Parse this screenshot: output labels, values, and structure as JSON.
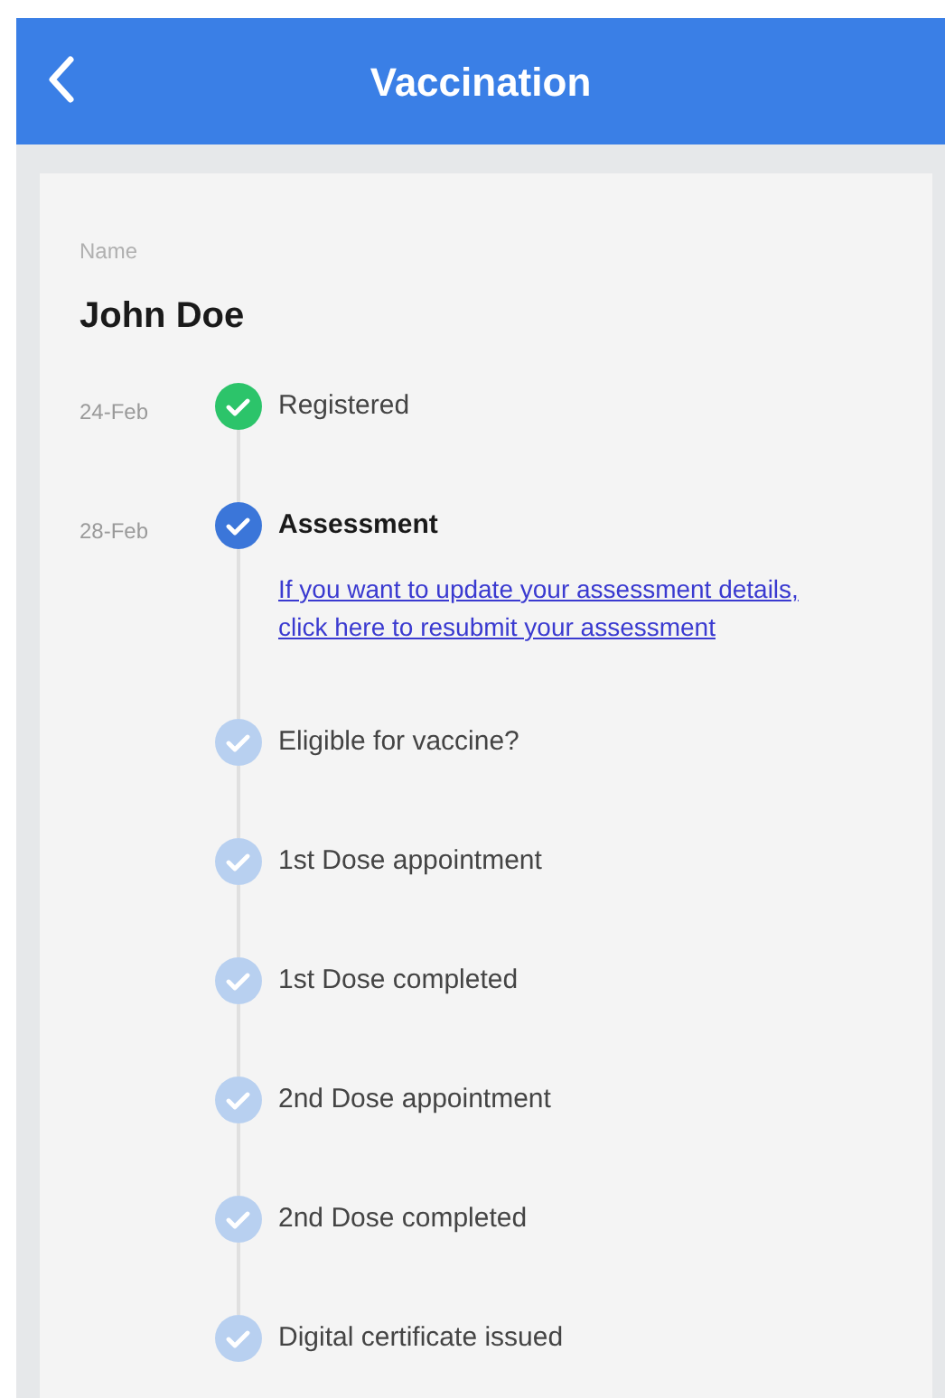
{
  "header": {
    "title": "Vaccination"
  },
  "name_label": "Name",
  "name": "John Doe",
  "steps": [
    {
      "date": "24-Feb",
      "label": "Registered",
      "kind": "done"
    },
    {
      "date": "28-Feb",
      "label": "Assessment",
      "kind": "current",
      "link": "If you want to update your assessment details, click here to resubmit your assessment"
    },
    {
      "label": "Eligible for vaccine?",
      "kind": "pending"
    },
    {
      "label": "1st Dose appointment",
      "kind": "pending"
    },
    {
      "label": "1st Dose completed",
      "kind": "pending"
    },
    {
      "label": "2nd Dose appointment",
      "kind": "pending"
    },
    {
      "label": "2nd Dose completed",
      "kind": "pending"
    },
    {
      "label": "Digital certificate issued",
      "kind": "pending"
    }
  ]
}
